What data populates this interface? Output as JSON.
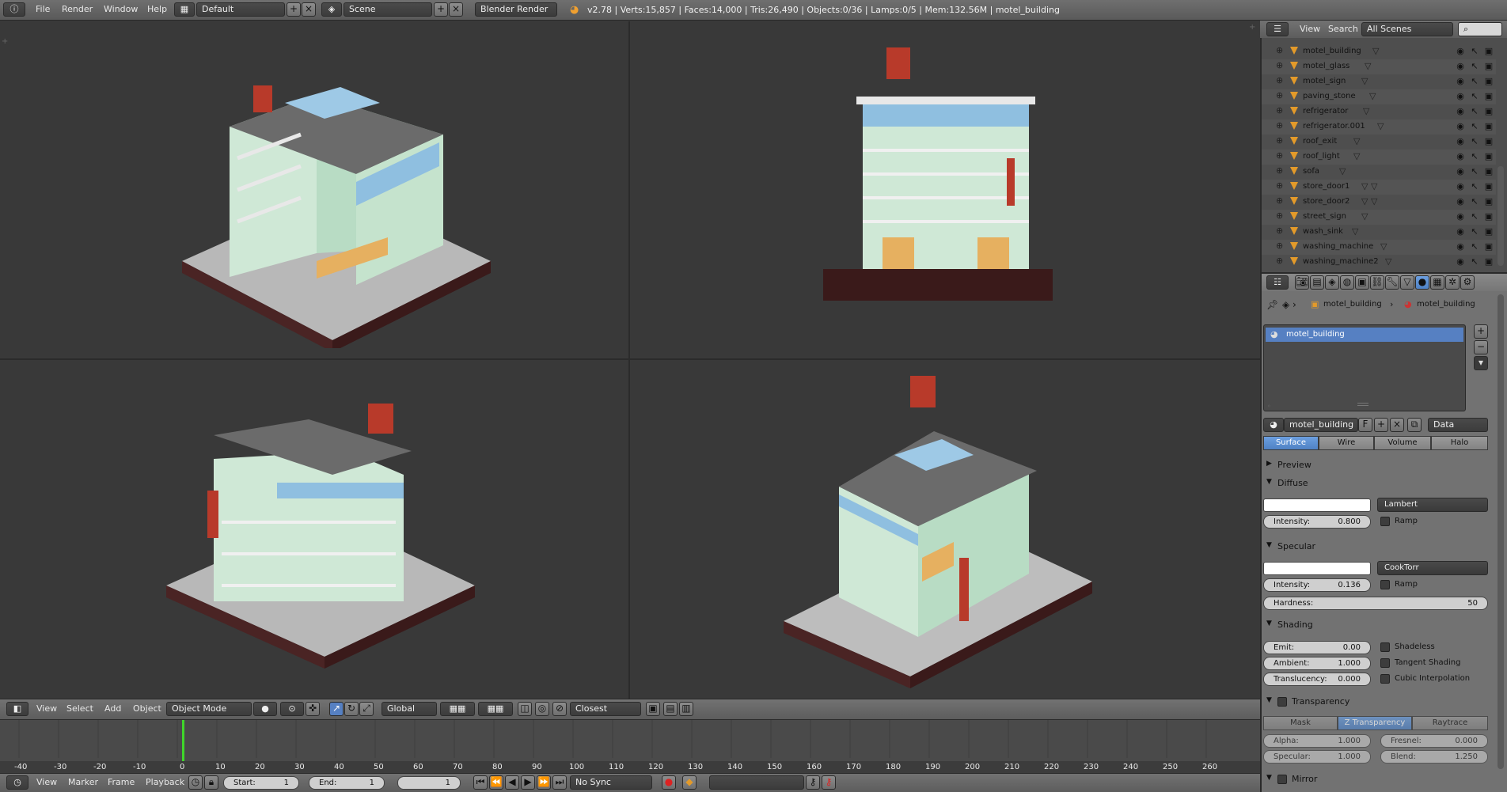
{
  "topbar": {
    "menus": [
      "File",
      "Render",
      "Window",
      "Help"
    ],
    "layout": "Default",
    "scene": "Scene",
    "engine": "Blender Render",
    "stats": "v2.78 | Verts:15,857 | Faces:14,000 | Tris:26,490 | Objects:0/36 | Lamps:0/5 | Mem:132.56M | motel_building"
  },
  "view3d": {
    "menus": [
      "View",
      "Select",
      "Add",
      "Object"
    ],
    "mode": "Object Mode",
    "orientation": "Global",
    "snap": "Closest"
  },
  "timeline": {
    "ticks": [
      "-40",
      "-30",
      "-20",
      "-10",
      "0",
      "10",
      "20",
      "30",
      "40",
      "50",
      "60",
      "70",
      "80",
      "90",
      "100",
      "110",
      "120",
      "130",
      "140",
      "150",
      "160",
      "170",
      "180",
      "190",
      "200",
      "210",
      "220",
      "230",
      "240",
      "250",
      "260"
    ],
    "menus": [
      "View",
      "Marker",
      "Frame",
      "Playback"
    ],
    "start": "Start:",
    "start_val": "1",
    "end": "End:",
    "end_val": "1",
    "current": "1",
    "sync": "No Sync"
  },
  "outliner": {
    "menus": [
      "View",
      "Search"
    ],
    "scenes": "All Scenes",
    "items": [
      "motel_building",
      "motel_glass",
      "motel_sign",
      "paving_stone",
      "refrigerator",
      "refrigerator.001",
      "roof_exit",
      "roof_light",
      "sofa",
      "store_door1",
      "store_door2",
      "street_sign",
      "wash_sink",
      "washing_machine",
      "washing_machine2"
    ]
  },
  "properties": {
    "breadcrumb_obj": "motel_building",
    "breadcrumb_mat": "motel_building",
    "slot": "motel_building",
    "material": "motel_building",
    "f_label": "F",
    "data": "Data",
    "tabs": [
      "Surface",
      "Wire",
      "Volume",
      "Halo"
    ],
    "preview": "Preview",
    "diffuse": "Diffuse",
    "diffuse_shader": "Lambert",
    "intensity": "Intensity:",
    "diffuse_intensity": "0.800",
    "ramp": "Ramp",
    "specular": "Specular",
    "specular_shader": "CookTorr",
    "specular_intensity": "0.136",
    "hardness": "Hardness:",
    "hardness_val": "50",
    "shading": "Shading",
    "emit": "Emit:",
    "emit_val": "0.00",
    "ambient": "Ambient:",
    "ambient_val": "1.000",
    "translucency": "Translucency:",
    "translucency_val": "0.000",
    "shadeless": "Shadeless",
    "tangent": "Tangent Shading",
    "cubic": "Cubic Interpolation",
    "transparency": "Transparency",
    "trans_tabs": [
      "Mask",
      "Z Transparency",
      "Raytrace"
    ],
    "alpha": "Alpha:",
    "alpha_val": "1.000",
    "fresnel": "Fresnel:",
    "fresnel_val": "0.000",
    "spec": "Specular:",
    "spec_val": "1.000",
    "blend": "Blend:",
    "blend_val": "1.250",
    "mirror": "Mirror"
  },
  "colors": {
    "accent": "#5680c2",
    "building": "#cfe8d6",
    "roof": "#6b6b6b",
    "tank": "#b83a2a",
    "ground": "#bdbdbd"
  }
}
